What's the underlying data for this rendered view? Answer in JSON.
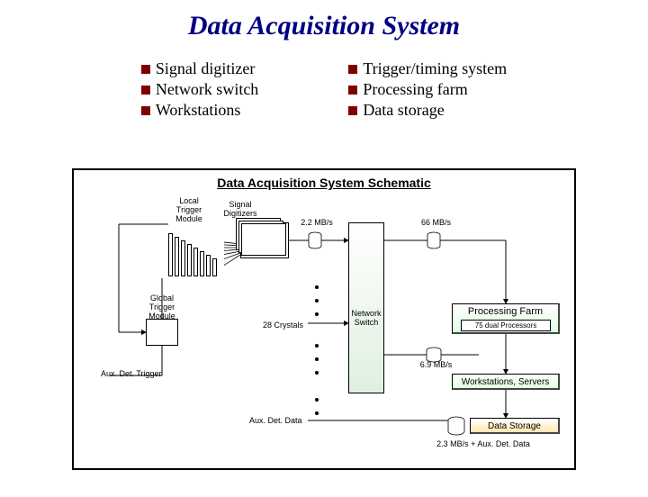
{
  "title": "Data Acquisition System",
  "bullets_left": [
    "Signal digitizer",
    "Network switch",
    "Workstations"
  ],
  "bullets_right": [
    "Trigger/timing system",
    "Processing farm",
    "Data storage"
  ],
  "schematic_title": "Data Acquisition System Schematic",
  "labels": {
    "local_trigger": "Local\nTrigger\nModule",
    "signal_digitizers": "Signal\nDigitizers",
    "rate_22": "2.2 MB/s",
    "rate_66": "66 MB/s",
    "rate_69": "6.9 MB/s",
    "rate_23": "2.3 MB/s + Aux. Det. Data",
    "global_trigger": "Global\nTrigger\nModule",
    "n_crystals": "28 Crystals",
    "network_switch": "Network\nSwitch",
    "processing_farm": "Processing Farm",
    "processors": "75 dual Processors",
    "workstations": "Workstations, Servers",
    "data_storage": "Data Storage",
    "aux_trigger": "Aux. Det. Trigger",
    "aux_data": "Aux. Det. Data"
  }
}
